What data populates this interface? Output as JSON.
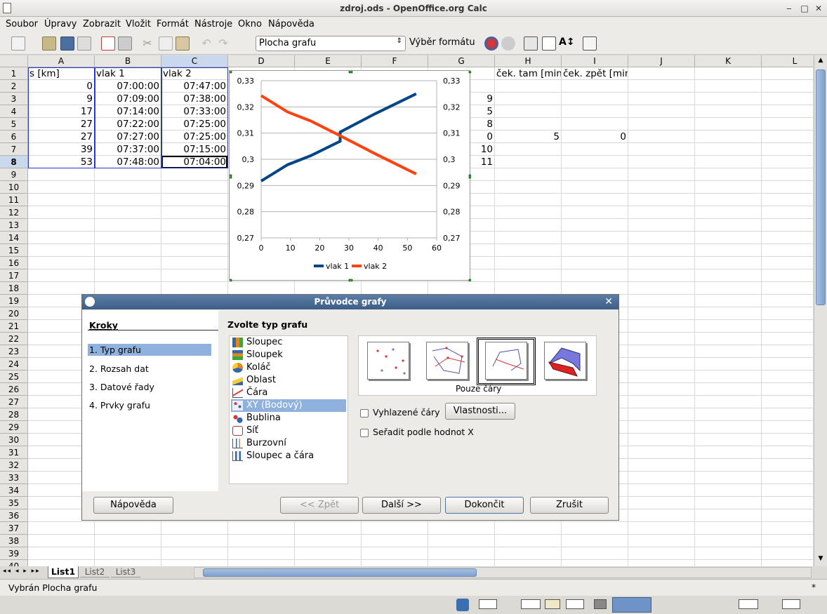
{
  "window": {
    "title": "zdroj.ods - OpenOffice.org Calc"
  },
  "menu": [
    "Soubor",
    "Úpravy",
    "Zobrazit",
    "Vložit",
    "Formát",
    "Nástroje",
    "Okno",
    "Nápověda"
  ],
  "toolbar": {
    "object_combo": "Plocha grafu",
    "format_label": "Výběr formátu"
  },
  "sheet": {
    "columns": [
      "A",
      "B",
      "C",
      "D",
      "E",
      "F",
      "G",
      "H",
      "I",
      "J",
      "K",
      "L"
    ],
    "rows": [
      "1",
      "2",
      "3",
      "4",
      "5",
      "6",
      "7",
      "8",
      "9",
      "10",
      "11",
      "12",
      "13",
      "14",
      "15",
      "16",
      "17",
      "18",
      "19",
      "20",
      "21",
      "22",
      "23",
      "24",
      "25",
      "26",
      "27",
      "28",
      "29",
      "30",
      "31",
      "32",
      "33",
      "34",
      "35",
      "36",
      "37",
      "38",
      "39",
      "40"
    ],
    "header_row": {
      "A": "s [km]",
      "B": "vlak 1",
      "C": "vlak 2",
      "H": "ček. tam [min]",
      "I": "ček. zpět [min]"
    },
    "col_A": [
      "0",
      "9",
      "17",
      "27",
      "27",
      "39",
      "53"
    ],
    "col_B": [
      "07:00:00",
      "07:09:00",
      "07:14:00",
      "07:22:00",
      "07:27:00",
      "07:37:00",
      "07:48:00"
    ],
    "col_C": [
      "07:47:00",
      "07:38:00",
      "07:33:00",
      "07:25:00",
      "07:25:00",
      "07:15:00",
      "07:04:00"
    ],
    "col_G": [
      "9",
      "5",
      "8",
      "0",
      "10",
      "11"
    ],
    "h6": "5",
    "i6": "0"
  },
  "chart_data": {
    "type": "scatter",
    "title": "",
    "xlim": [
      0,
      60
    ],
    "ylim": [
      0.27,
      0.33
    ],
    "x_ticks": [
      "0",
      "10",
      "20",
      "30",
      "40",
      "50",
      "60"
    ],
    "y_ticks": [
      "0,33",
      "0,32",
      "0,31",
      "0,3",
      "0,29",
      "0,28",
      "0,27"
    ],
    "grid": true,
    "legend": "bottom",
    "series": [
      {
        "name": "vlak 1",
        "color": "#004586",
        "x": [
          0,
          9,
          17,
          27,
          27,
          39,
          53
        ],
        "y": [
          0.2917,
          0.2979,
          0.3014,
          0.3069,
          0.3104,
          0.3174,
          0.325
        ]
      },
      {
        "name": "vlak 2",
        "color": "#ff420e",
        "x": [
          0,
          9,
          17,
          27,
          27,
          39,
          53
        ],
        "y": [
          0.3243,
          0.3181,
          0.3146,
          0.309,
          0.309,
          0.3021,
          0.2944
        ]
      }
    ]
  },
  "dialog": {
    "title": "Průvodce grafy",
    "steps_heading": "Kroky",
    "steps": [
      "1. Typ grafu",
      "2. Rozsah dat",
      "3. Datové řady",
      "4. Prvky grafu"
    ],
    "type_heading": "Zvolte typ grafu",
    "chart_types": [
      "Sloupec",
      "Sloupek",
      "Koláč",
      "Oblast",
      "Čára",
      "XY (Bodový)",
      "Bublina",
      "Síť",
      "Burzovní",
      "Sloupec a čára"
    ],
    "selected_variant": "Pouze čáry",
    "smooth_label": "Vyhlazené čáry",
    "properties_button": "Vlastnosti...",
    "sort_label": "Seřadit podle hodnot X",
    "help_button": "Nápověda",
    "back_button": "<< Zpět",
    "next_button": "Další >>",
    "finish_button": "Dokončit",
    "cancel_button": "Zrušit"
  },
  "tabs": [
    "List1",
    "List2",
    "List3"
  ],
  "status": {
    "text": "Vybrán Plocha grafu",
    "mark": "*"
  }
}
